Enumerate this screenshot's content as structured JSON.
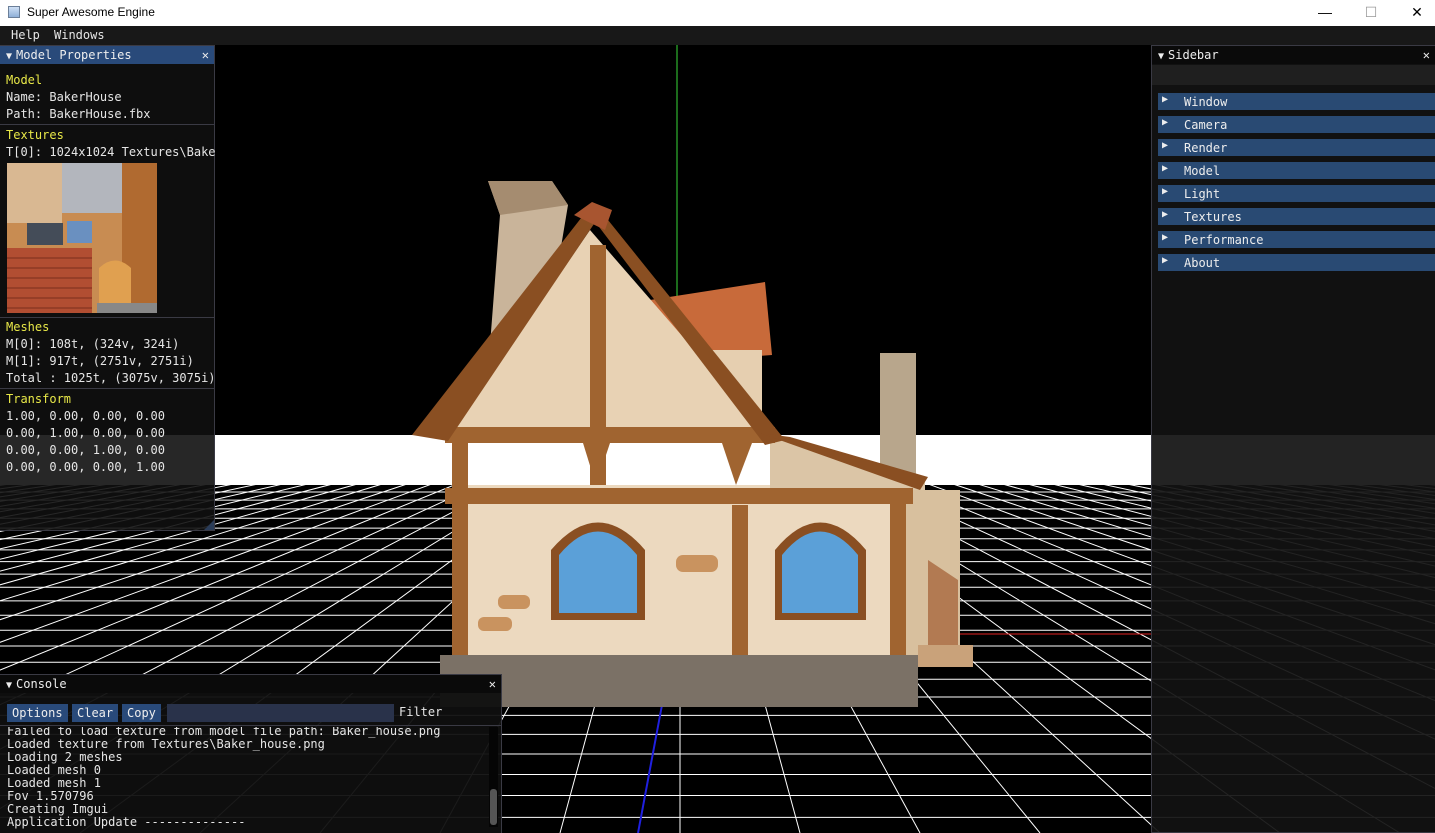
{
  "window": {
    "title": "Super Awesome Engine",
    "minimize": "—",
    "maximize": "☐",
    "close": "✕"
  },
  "menu": {
    "items": [
      "Help",
      "Windows"
    ]
  },
  "model_properties": {
    "title": "Model Properties",
    "model_heading": "Model",
    "name": "Name: BakerHouse",
    "path": "Path: BakerHouse.fbx",
    "textures_heading": "Textures",
    "texture_line": "T[0]: 1024x1024 Textures\\Bake",
    "meshes_heading": "Meshes",
    "meshes": [
      "M[0]: 108t, (324v, 324i)",
      "M[1]: 917t, (2751v, 2751i)",
      "Total : 1025t, (3075v, 3075i)"
    ],
    "transform_heading": "Transform",
    "transform": [
      "1.00, 0.00, 0.00, 0.00",
      "0.00, 1.00, 0.00, 0.00",
      "0.00, 0.00, 1.00, 0.00",
      "0.00, 0.00, 0.00, 1.00"
    ]
  },
  "sidebar": {
    "title": "Sidebar",
    "items": [
      {
        "label": "Window"
      },
      {
        "label": "Camera"
      },
      {
        "label": "Render"
      },
      {
        "label": "Model"
      },
      {
        "label": "Light"
      },
      {
        "label": "Textures"
      },
      {
        "label": "Performance"
      },
      {
        "label": "About"
      }
    ]
  },
  "console": {
    "title": "Console",
    "options": "Options",
    "clear": "Clear",
    "copy": "Copy",
    "filter_label": "Filter",
    "filter_value": "",
    "log": [
      "Failed to load texture from model file path: Baker_house.png",
      "Loaded texture from Textures\\Baker_house.png",
      "Loading 2 meshes",
      "Loaded mesh 0",
      "Loaded mesh 1",
      "Fov 1.570796",
      "Creating Imgui",
      "Application Update --------------"
    ]
  },
  "icons": {
    "collapse": "collapse-arrow-icon",
    "close": "close-icon",
    "expand": "expand-arrow-icon"
  },
  "colors": {
    "title_active": "#294a7a",
    "header": "#294a73",
    "heading_text": "#e8e848"
  }
}
